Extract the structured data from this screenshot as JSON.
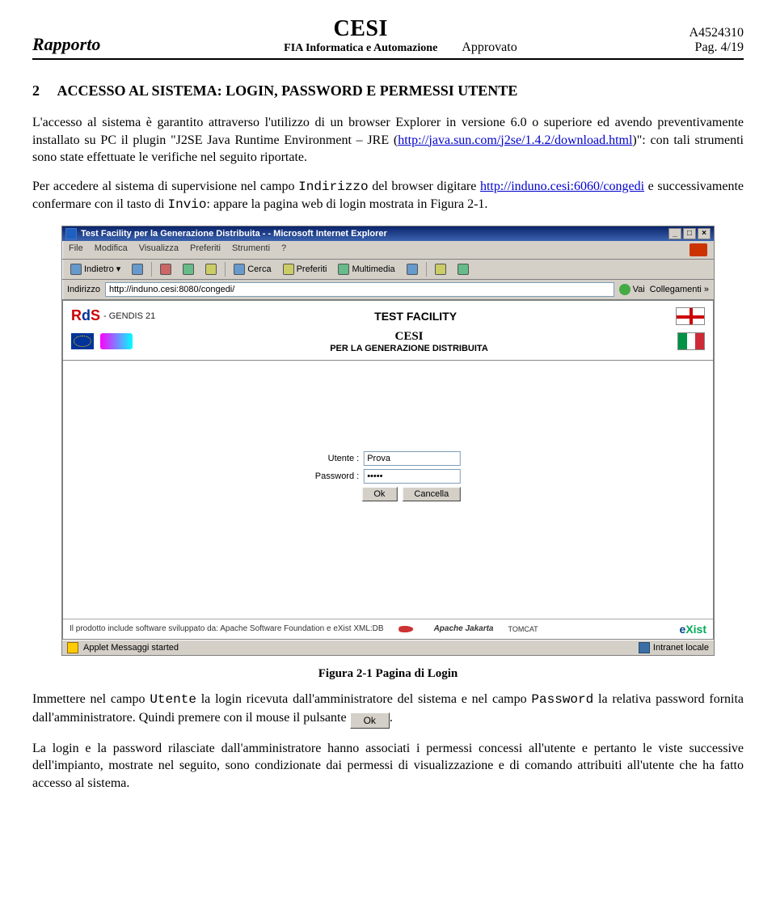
{
  "header": {
    "docType": "Rapporto",
    "logo": "CESI",
    "subtitle": "FIA Informatica e Automazione",
    "approved": "Approvato",
    "code": "A4524310",
    "page": "Pag. 4/19"
  },
  "section": {
    "num": "2",
    "title": "ACCESSO AL SISTEMA: LOGIN, PASSWORD E PERMESSI UTENTE"
  },
  "para1a": "L'accesso al sistema è garantito attraverso l'utilizzo di un browser Explorer in versione 6.0 o superiore ed avendo preventivamente installato su PC il plugin \"J2SE Java Runtime Environment – JRE (",
  "link1": "http://java.sun.com/j2se/1.4.2/download.html",
  "para1b": ")\": con tali strumenti sono state effettuate le verifiche nel seguito riportate.",
  "para2a": "Per accedere al sistema di supervisione nel campo ",
  "para2code1": "Indirizzo",
  "para2b": " del browser digitare ",
  "link2": "http://induno.cesi:6060/congedi",
  "para2c": " e successivamente confermare con il tasto di ",
  "para2code2": "Invio",
  "para2d": ": appare la pagina web di login mostrata in Figura 2-1.",
  "ie": {
    "title": "Test Facility per la Generazione Distribuita - - Microsoft Internet Explorer",
    "menu": {
      "file": "File",
      "mod": "Modifica",
      "vis": "Visualizza",
      "pref": "Preferiti",
      "strum": "Strumenti",
      "help": "?"
    },
    "tb": {
      "back": "Indietro",
      "search": "Cerca",
      "fav": "Preferiti",
      "media": "Multimedia"
    },
    "addrLabel": "Indirizzo",
    "addrValue": "http://induno.cesi:8080/congedi/",
    "go": "Vai",
    "links": "Collegamenti",
    "page": {
      "rds": "RdS",
      "gendis": "- GENDIS 21",
      "tf": "TEST FACILITY",
      "cesi": "CESI",
      "sub": "PER LA GENERAZIONE DISTRIBUITA"
    },
    "login": {
      "userLabel": "Utente :",
      "userValue": "Prova",
      "passLabel": "Password :",
      "passValue": "•••••",
      "ok": "Ok",
      "cancel": "Cancella"
    },
    "cfoot": {
      "text": "Il prodotto include software sviluppato da: Apache Software Foundation e eXist XML:DB",
      "jak": "Apache Jakarta",
      "tom": "TOMCAT",
      "exist": "eXist"
    },
    "status": {
      "msg": "Applet Messaggi started",
      "zone": "Intranet locale"
    }
  },
  "figCaption": "Figura 2-1 Pagina di Login",
  "para3a": "Immettere nel campo ",
  "para3code1": "Utente",
  "para3b": " la login ricevuta dall'amministratore del sistema e nel campo ",
  "para3code2": "Password",
  "para3c": " la relativa password fornita dall'amministratore. Quindi premere con il mouse il pulsante ",
  "okInline": "Ok",
  "para3d": ".",
  "para4": "La login e la password rilasciate dall'amministratore hanno associati i permessi concessi all'utente e pertanto le viste successive dell'impianto, mostrate nel seguito, sono condizionate dai permessi di visualizzazione e di comando attribuiti all'utente che ha fatto accesso al sistema."
}
